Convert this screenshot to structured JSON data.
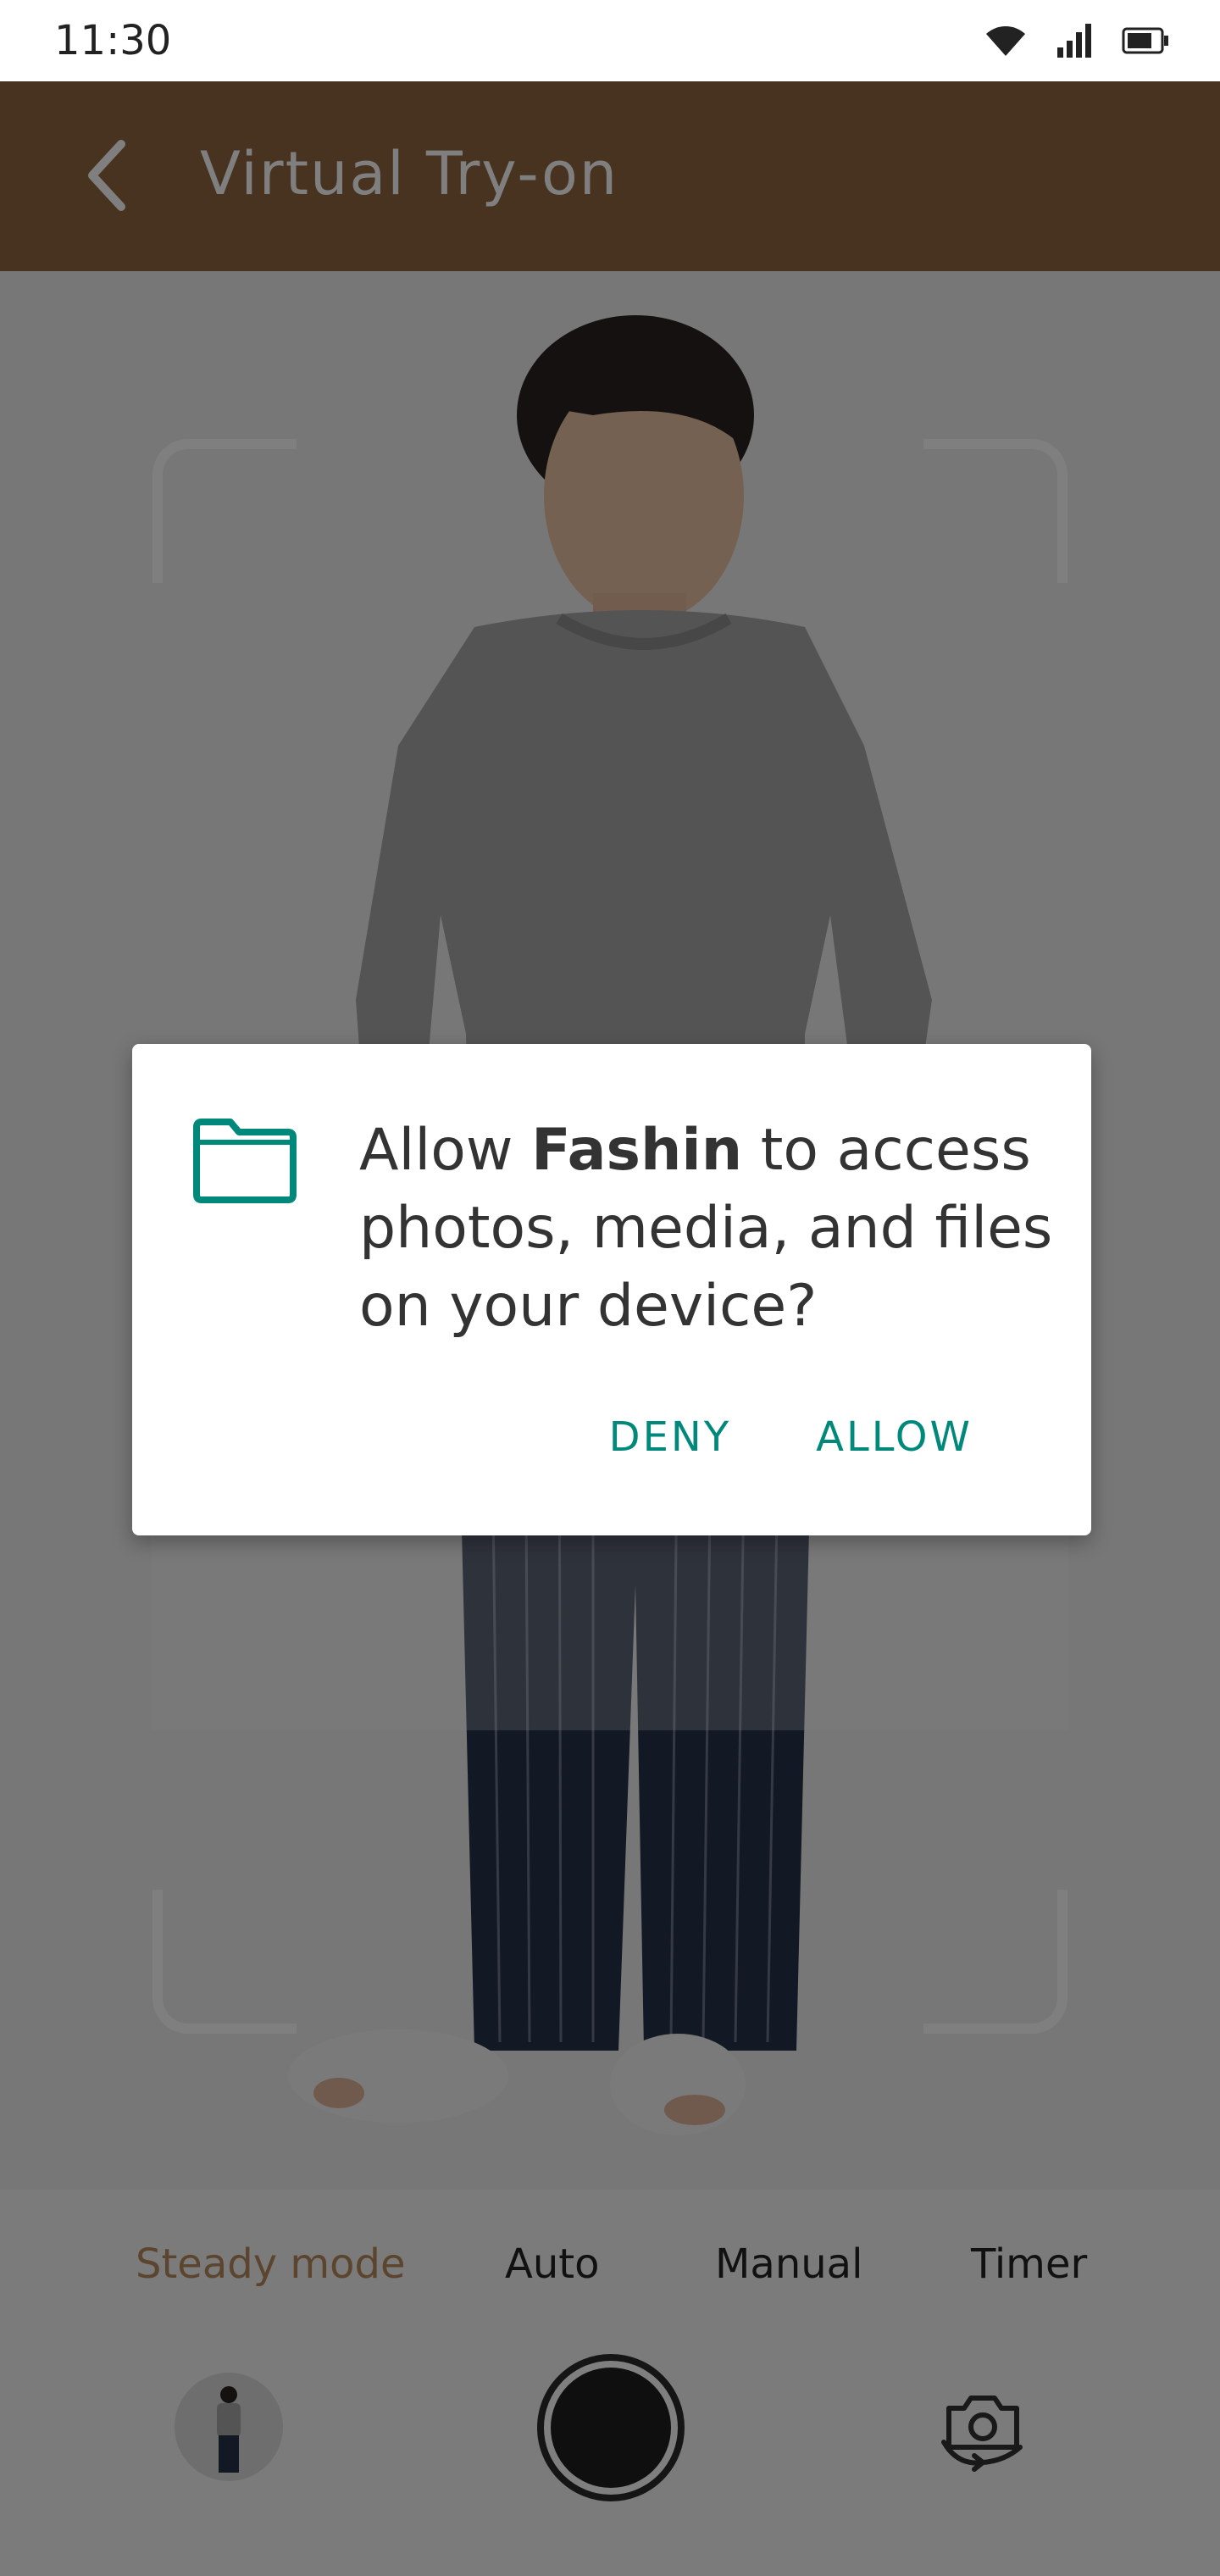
{
  "status_bar": {
    "time": "11:30"
  },
  "app_bar": {
    "title": "Virtual Try-on"
  },
  "modes": [
    {
      "label": "Steady mode",
      "active": true
    },
    {
      "label": "Auto",
      "active": false
    },
    {
      "label": "Manual",
      "active": false
    },
    {
      "label": "Timer",
      "active": false
    }
  ],
  "dialog": {
    "message_prefix": "Allow ",
    "app_name": "Fashin",
    "message_suffix": " to access photos, media, and files on your device?",
    "deny_label": "DENY",
    "allow_label": "ALLOW"
  },
  "colors": {
    "app_bar": "#8e6640",
    "accent": "#00897b",
    "active_mode": "#b78a5c"
  },
  "icons": {
    "back": "chevron-left-icon",
    "folder": "folder-icon",
    "flip_camera": "flip-camera-icon"
  }
}
